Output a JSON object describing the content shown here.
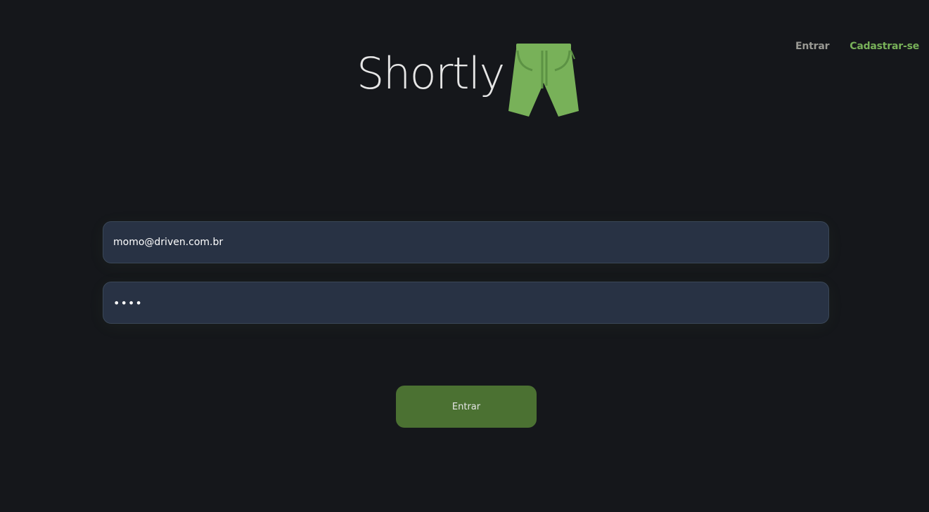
{
  "header": {
    "logo_text": "Shortly",
    "logo_icon": "shorts-icon",
    "nav": {
      "login_label": "Entrar",
      "signup_label": "Cadastrar-se"
    }
  },
  "login_form": {
    "email_value": "momo@driven.com.br",
    "password_value": "••••",
    "submit_label": "Entrar"
  },
  "colors": {
    "background": "#15171b",
    "accent_green": "#78b159",
    "button_green": "#4b7132",
    "input_background": "#283244"
  }
}
